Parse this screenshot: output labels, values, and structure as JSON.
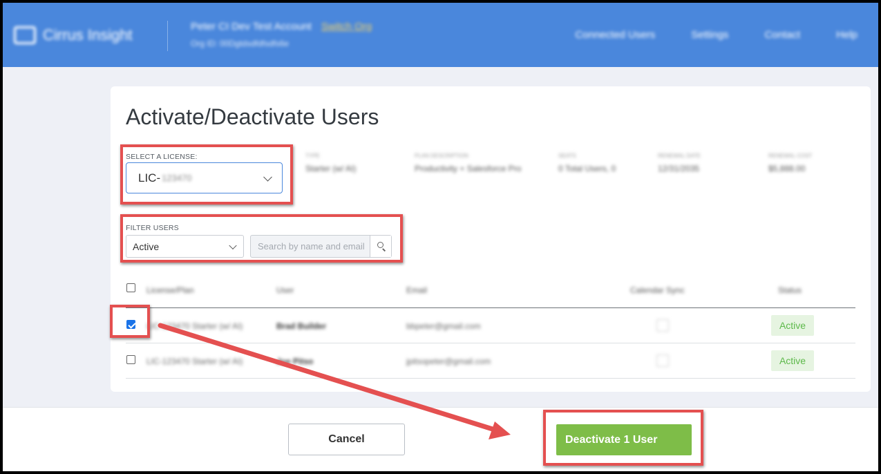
{
  "brand": {
    "name": "Cirrus Insight"
  },
  "account": {
    "name": "Peter CI Dev Test Account",
    "switch_label": "Switch Org",
    "sub": "Org ID: 00Dgtdsdfdfsdfs6e"
  },
  "nav": [
    "Connected Users",
    "Settings",
    "Contact",
    "Help"
  ],
  "page": {
    "title": "Activate/Deactivate Users"
  },
  "license": {
    "label": "SELECT A LICENSE:",
    "value_prefix": "LIC-",
    "value_rest": "123470",
    "meta": [
      {
        "key": "TYPE",
        "value": "Starter (w/ AI)"
      },
      {
        "key": "PLAN DESCRIPTION",
        "value": "Productivity + Salesforce Pro"
      },
      {
        "key": "SEATS",
        "value": "0 Total Users, 0"
      },
      {
        "key": "RENEWAL DATE",
        "value": "12/31/2035"
      },
      {
        "key": "RENEWAL COST",
        "value": "$5,888.00"
      }
    ]
  },
  "filter": {
    "label": "FILTER USERS",
    "value": "Active",
    "search_placeholder": "Search by name and email"
  },
  "table": {
    "columns": [
      "License/Plan",
      "User",
      "Email",
      "Calendar Sync",
      "Status"
    ],
    "rows": [
      {
        "checked": true,
        "license": "LIC-123470 Starter (w/ AI)",
        "user": "Brad Builder",
        "email": "bbpeter@gmail.com",
        "status": "Active"
      },
      {
        "checked": false,
        "license": "LIC-123470 Starter (w/ AI)",
        "user": "Joe Pitso",
        "email": "jpitsopeter@gmail.com",
        "status": "Active"
      }
    ]
  },
  "footer": {
    "cancel_label": "Cancel",
    "deactivate_label": "Deactivate 1 User"
  },
  "colors": {
    "nav": "#4a87dc",
    "primary_green": "#7ebd48",
    "annotation_red": "#e45050",
    "checkbox_blue": "#1a73e8"
  }
}
